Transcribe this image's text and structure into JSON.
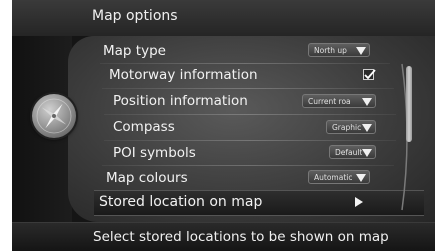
{
  "header": {
    "title": "Map options"
  },
  "menu": {
    "items": [
      {
        "label": "Map type",
        "value": "North up"
      },
      {
        "label": "Motorway information",
        "checked": true
      },
      {
        "label": "Position information",
        "value": "Current roa"
      },
      {
        "label": "Compass",
        "value": "Graphic"
      },
      {
        "label": "POI symbols",
        "value": "Default"
      },
      {
        "label": "Map colours",
        "value": "Automatic"
      },
      {
        "label": "Stored location on map"
      }
    ]
  },
  "help": {
    "text": "Select stored locations to be shown on map"
  },
  "icons": {
    "app": "compass-icon",
    "submenu": "play-arrow-icon",
    "dropdown": "dropdown-arrow-icon",
    "check": "checkmark-icon"
  }
}
